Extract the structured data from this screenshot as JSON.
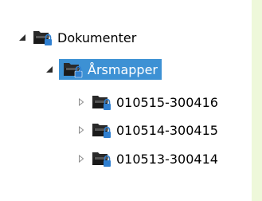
{
  "tree": {
    "root": {
      "label": "Dokumenter",
      "icon": "locked-folder-icon",
      "expanded": true
    },
    "child": {
      "label": "Årsmapper",
      "icon": "locked-folder-icon",
      "expanded": true,
      "selected": true
    },
    "grandchildren": [
      {
        "label": "010515-300416",
        "icon": "locked-folder-icon",
        "expanded": false
      },
      {
        "label": "010514-300415",
        "icon": "locked-folder-icon",
        "expanded": false
      },
      {
        "label": "010513-300414",
        "icon": "locked-folder-icon",
        "expanded": false
      }
    ]
  },
  "colors": {
    "background": "#eef8da",
    "selection": "#3d91d4"
  }
}
